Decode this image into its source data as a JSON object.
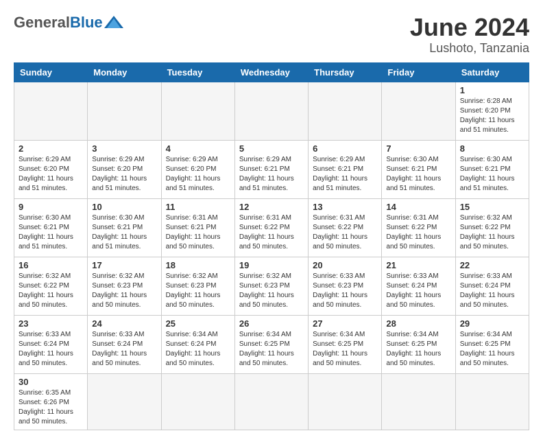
{
  "header": {
    "logo_general": "General",
    "logo_blue": "Blue",
    "month_title": "June 2024",
    "location": "Lushoto, Tanzania"
  },
  "weekdays": [
    "Sunday",
    "Monday",
    "Tuesday",
    "Wednesday",
    "Thursday",
    "Friday",
    "Saturday"
  ],
  "days": {
    "d1": {
      "num": "1",
      "sunrise": "6:28 AM",
      "sunset": "6:20 PM",
      "daylight": "11 hours and 51 minutes."
    },
    "d2": {
      "num": "2",
      "sunrise": "6:29 AM",
      "sunset": "6:20 PM",
      "daylight": "11 hours and 51 minutes."
    },
    "d3": {
      "num": "3",
      "sunrise": "6:29 AM",
      "sunset": "6:20 PM",
      "daylight": "11 hours and 51 minutes."
    },
    "d4": {
      "num": "4",
      "sunrise": "6:29 AM",
      "sunset": "6:20 PM",
      "daylight": "11 hours and 51 minutes."
    },
    "d5": {
      "num": "5",
      "sunrise": "6:29 AM",
      "sunset": "6:21 PM",
      "daylight": "11 hours and 51 minutes."
    },
    "d6": {
      "num": "6",
      "sunrise": "6:29 AM",
      "sunset": "6:21 PM",
      "daylight": "11 hours and 51 minutes."
    },
    "d7": {
      "num": "7",
      "sunrise": "6:30 AM",
      "sunset": "6:21 PM",
      "daylight": "11 hours and 51 minutes."
    },
    "d8": {
      "num": "8",
      "sunrise": "6:30 AM",
      "sunset": "6:21 PM",
      "daylight": "11 hours and 51 minutes."
    },
    "d9": {
      "num": "9",
      "sunrise": "6:30 AM",
      "sunset": "6:21 PM",
      "daylight": "11 hours and 51 minutes."
    },
    "d10": {
      "num": "10",
      "sunrise": "6:30 AM",
      "sunset": "6:21 PM",
      "daylight": "11 hours and 51 minutes."
    },
    "d11": {
      "num": "11",
      "sunrise": "6:31 AM",
      "sunset": "6:21 PM",
      "daylight": "11 hours and 50 minutes."
    },
    "d12": {
      "num": "12",
      "sunrise": "6:31 AM",
      "sunset": "6:22 PM",
      "daylight": "11 hours and 50 minutes."
    },
    "d13": {
      "num": "13",
      "sunrise": "6:31 AM",
      "sunset": "6:22 PM",
      "daylight": "11 hours and 50 minutes."
    },
    "d14": {
      "num": "14",
      "sunrise": "6:31 AM",
      "sunset": "6:22 PM",
      "daylight": "11 hours and 50 minutes."
    },
    "d15": {
      "num": "15",
      "sunrise": "6:32 AM",
      "sunset": "6:22 PM",
      "daylight": "11 hours and 50 minutes."
    },
    "d16": {
      "num": "16",
      "sunrise": "6:32 AM",
      "sunset": "6:22 PM",
      "daylight": "11 hours and 50 minutes."
    },
    "d17": {
      "num": "17",
      "sunrise": "6:32 AM",
      "sunset": "6:23 PM",
      "daylight": "11 hours and 50 minutes."
    },
    "d18": {
      "num": "18",
      "sunrise": "6:32 AM",
      "sunset": "6:23 PM",
      "daylight": "11 hours and 50 minutes."
    },
    "d19": {
      "num": "19",
      "sunrise": "6:32 AM",
      "sunset": "6:23 PM",
      "daylight": "11 hours and 50 minutes."
    },
    "d20": {
      "num": "20",
      "sunrise": "6:33 AM",
      "sunset": "6:23 PM",
      "daylight": "11 hours and 50 minutes."
    },
    "d21": {
      "num": "21",
      "sunrise": "6:33 AM",
      "sunset": "6:24 PM",
      "daylight": "11 hours and 50 minutes."
    },
    "d22": {
      "num": "22",
      "sunrise": "6:33 AM",
      "sunset": "6:24 PM",
      "daylight": "11 hours and 50 minutes."
    },
    "d23": {
      "num": "23",
      "sunrise": "6:33 AM",
      "sunset": "6:24 PM",
      "daylight": "11 hours and 50 minutes."
    },
    "d24": {
      "num": "24",
      "sunrise": "6:33 AM",
      "sunset": "6:24 PM",
      "daylight": "11 hours and 50 minutes."
    },
    "d25": {
      "num": "25",
      "sunrise": "6:34 AM",
      "sunset": "6:24 PM",
      "daylight": "11 hours and 50 minutes."
    },
    "d26": {
      "num": "26",
      "sunrise": "6:34 AM",
      "sunset": "6:25 PM",
      "daylight": "11 hours and 50 minutes."
    },
    "d27": {
      "num": "27",
      "sunrise": "6:34 AM",
      "sunset": "6:25 PM",
      "daylight": "11 hours and 50 minutes."
    },
    "d28": {
      "num": "28",
      "sunrise": "6:34 AM",
      "sunset": "6:25 PM",
      "daylight": "11 hours and 50 minutes."
    },
    "d29": {
      "num": "29",
      "sunrise": "6:34 AM",
      "sunset": "6:25 PM",
      "daylight": "11 hours and 50 minutes."
    },
    "d30": {
      "num": "30",
      "sunrise": "6:35 AM",
      "sunset": "6:26 PM",
      "daylight": "11 hours and 50 minutes."
    }
  },
  "labels": {
    "sunrise": "Sunrise:",
    "sunset": "Sunset:",
    "daylight": "Daylight:"
  }
}
